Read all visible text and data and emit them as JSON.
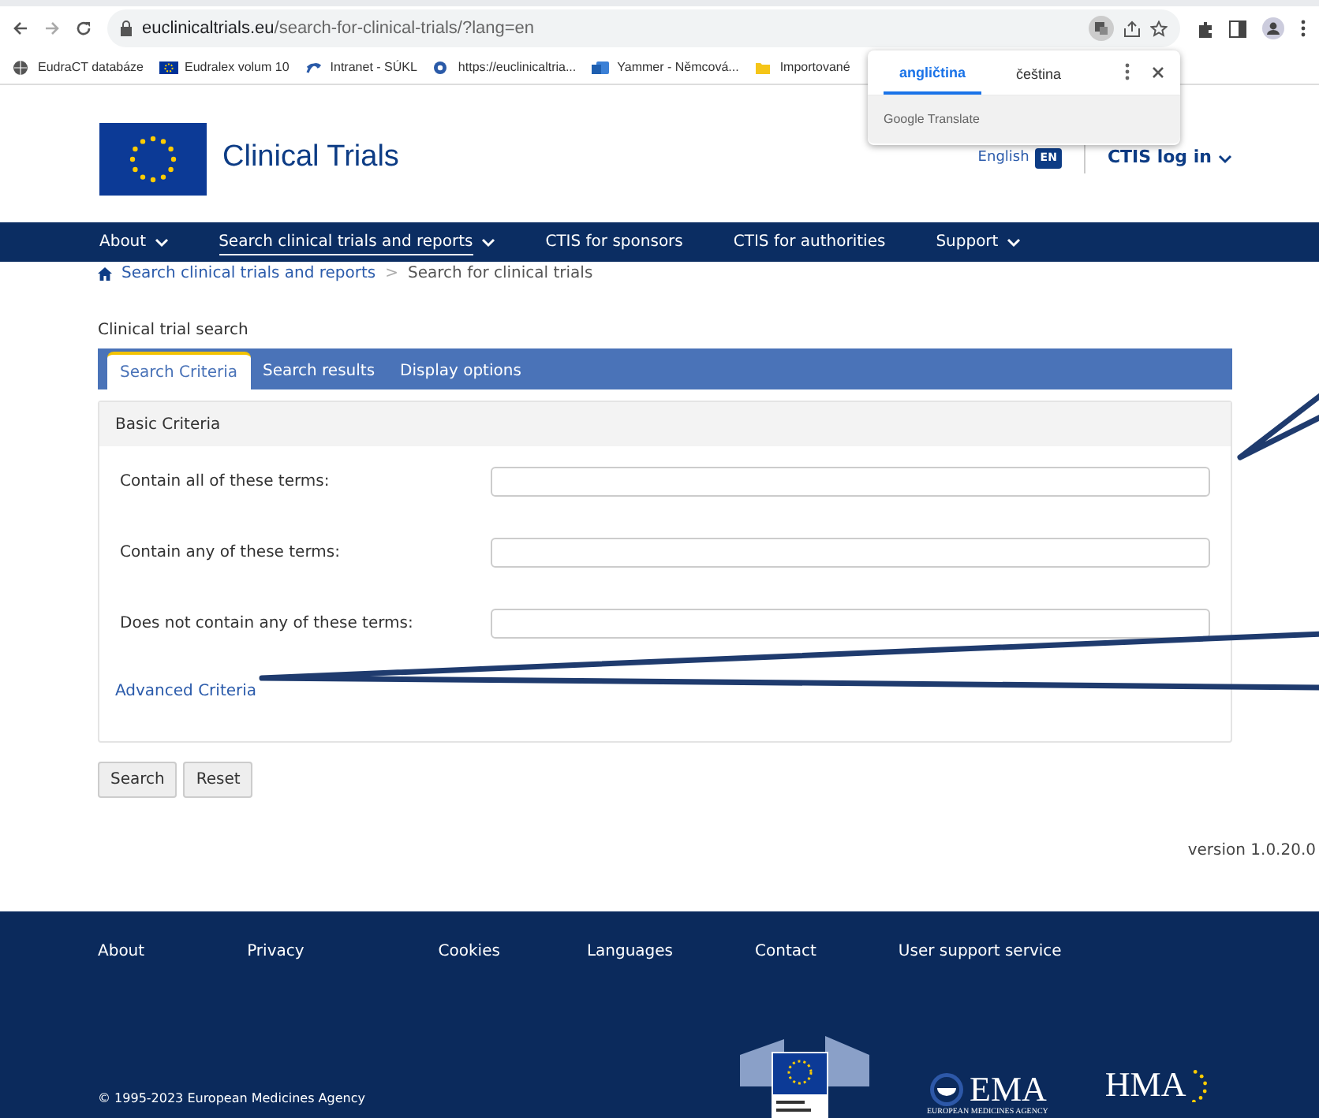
{
  "browser": {
    "url_host": "euclinicaltrials.eu",
    "url_path": "/search-for-clinical-trials/?lang=en",
    "bookmarks": [
      {
        "label": "EudraCT databáze",
        "kind": "globe"
      },
      {
        "label": "Eudralex volum 10",
        "kind": "flag"
      },
      {
        "label": "Intranet - SÚKL",
        "kind": "logo"
      },
      {
        "label": "https://euclinicaltria...",
        "kind": "dot"
      },
      {
        "label": "Yammer - Němcová...",
        "kind": "yammer"
      },
      {
        "label": "Importované",
        "kind": "folder"
      }
    ]
  },
  "translate_popup": {
    "tabs": [
      {
        "label": "angličtina",
        "selected": true
      },
      {
        "label": "čeština",
        "selected": false
      }
    ],
    "footer": "Google Translate"
  },
  "header": {
    "title": "Clinical Trials",
    "language": "English",
    "language_badge": "EN",
    "login": "CTIS log in"
  },
  "nav": [
    {
      "label": "About",
      "dropdown": true,
      "selected": false
    },
    {
      "label": "Search clinical trials and reports",
      "dropdown": true,
      "selected": true
    },
    {
      "label": "CTIS for sponsors",
      "dropdown": false,
      "selected": false
    },
    {
      "label": "CTIS for authorities",
      "dropdown": false,
      "selected": false
    },
    {
      "label": "Support",
      "dropdown": true,
      "selected": false
    }
  ],
  "breadcrumb": [
    {
      "label": "Search clinical trials and reports",
      "link": true
    },
    {
      "label": "Search for clinical trials",
      "link": false
    }
  ],
  "breadcrumb_separator": ">",
  "section_title": "Clinical trial search",
  "tabs": [
    {
      "label": "Search Criteria",
      "selected": true
    },
    {
      "label": "Search results",
      "selected": false
    },
    {
      "label": "Display options",
      "selected": false
    }
  ],
  "criteria": {
    "heading": "Basic Criteria",
    "fields": [
      {
        "label": "Contain all of these terms:"
      },
      {
        "label": "Contain any of these terms:"
      },
      {
        "label": "Does not contain any of these terms:"
      }
    ],
    "advanced_link": "Advanced Criteria"
  },
  "buttons": [
    "Search",
    "Reset"
  ],
  "version": "version 1.0.20.0",
  "footer": {
    "links": [
      "About",
      "Privacy",
      "Cookies",
      "Languages",
      "Contact",
      "User support service"
    ],
    "copyright": "© 1995-2023 European Medicines Agency",
    "ema_name": "EMA",
    "ema_sub": "EUROPEAN MEDICINES AGENCY",
    "hma_name": "HMA"
  }
}
